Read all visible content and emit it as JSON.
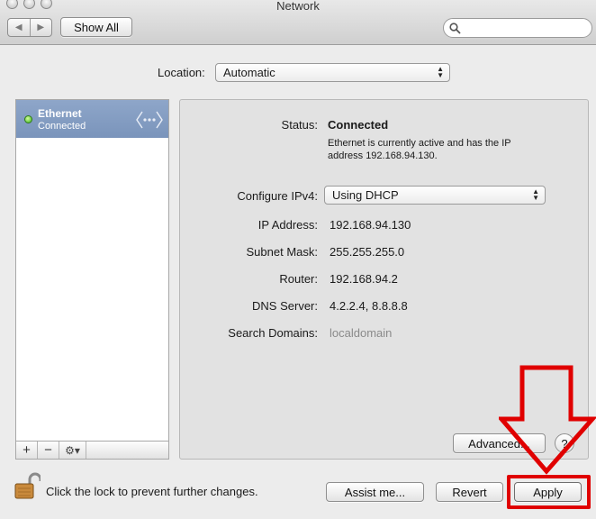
{
  "window": {
    "title": "Network",
    "toolbar": {
      "back_glyph": "◀",
      "forward_glyph": "▶",
      "show_all_label": "Show All",
      "search_placeholder": ""
    }
  },
  "location": {
    "label": "Location:",
    "value": "Automatic"
  },
  "services": [
    {
      "name": "Ethernet",
      "status": "Connected",
      "status_color": "#38b11d",
      "icon": "ethernet-icon"
    }
  ],
  "service_list_footer": {
    "add_label": "+",
    "remove_label": "−",
    "gear_label": "⚙▾"
  },
  "detail": {
    "status_label": "Status:",
    "status_value": "Connected",
    "status_description_line1": "Ethernet is currently active and has the IP",
    "status_description_line2": "address 192.168.94.130.",
    "configure_label": "Configure IPv4:",
    "configure_value": "Using DHCP",
    "ip_label": "IP Address:",
    "ip_value": "192.168.94.130",
    "subnet_label": "Subnet Mask:",
    "subnet_value": "255.255.255.0",
    "router_label": "Router:",
    "router_value": "192.168.94.2",
    "dns_label": "DNS Server:",
    "dns_value": "4.2.2.4, 8.8.8.8",
    "search_domains_label": "Search Domains:",
    "search_domains_value": "localdomain",
    "advanced_label": "Advanced...",
    "help_label": "?"
  },
  "bottom": {
    "lock_text": "Click the lock to prevent further changes.",
    "assist_label": "Assist me...",
    "revert_label": "Revert",
    "apply_label": "Apply"
  },
  "annotation": {
    "color": "#e00000"
  }
}
